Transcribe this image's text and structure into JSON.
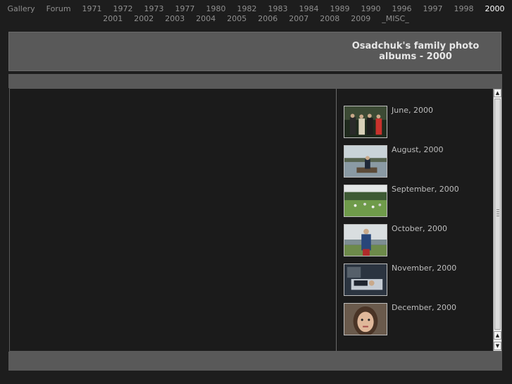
{
  "nav": {
    "row1": [
      "Gallery",
      "Forum",
      "1971",
      "1972",
      "1973",
      "1977",
      "1980",
      "1982",
      "1983",
      "1984",
      "1989",
      "1990",
      "1996",
      "1997",
      "1998",
      "2000"
    ],
    "row2": [
      "2001",
      "2002",
      "2003",
      "2004",
      "2005",
      "2006",
      "2007",
      "2008",
      "2009",
      "_MISC_"
    ],
    "active": "2000"
  },
  "header": {
    "title": "Osadchuk's family photo albums - 2000"
  },
  "albums": [
    {
      "label": "June, 2000",
      "thumb": "june-thumb"
    },
    {
      "label": "August, 2000",
      "thumb": "august-thumb"
    },
    {
      "label": "September, 2000",
      "thumb": "september-thumb"
    },
    {
      "label": "October, 2000",
      "thumb": "october-thumb"
    },
    {
      "label": "November, 2000",
      "thumb": "november-thumb"
    },
    {
      "label": "December, 2000",
      "thumb": "december-thumb"
    }
  ],
  "scrollbar": {
    "up": "▲",
    "down": "▼"
  },
  "colors": {
    "page_bg": "#1d1d1d",
    "panel": "#595959",
    "active_link": "#ffffff",
    "link": "#8f8f8f"
  }
}
